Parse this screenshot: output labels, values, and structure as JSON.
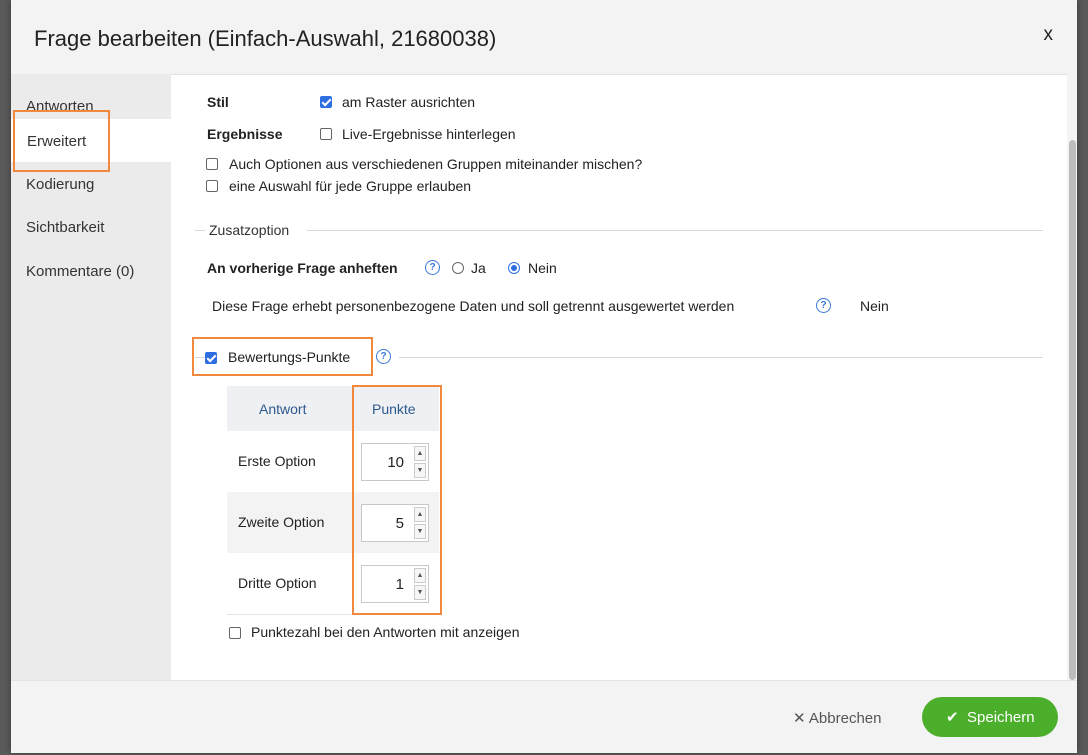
{
  "header": {
    "title": "Frage bearbeiten (Einfach-Auswahl, 21680038)",
    "close_label": "x"
  },
  "sidebar": {
    "items": [
      {
        "label": "Antworten",
        "active": false
      },
      {
        "label": "Erweitert",
        "active": true
      },
      {
        "label": "Kodierung",
        "active": false
      },
      {
        "label": "Sichtbarkeit",
        "active": false
      },
      {
        "label": "Kommentare (0)",
        "active": false
      }
    ]
  },
  "options": {
    "stil_label": "Stil",
    "stil_checkbox_label": "am Raster ausrichten",
    "stil_checked": true,
    "ergebnisse_label": "Ergebnisse",
    "ergebnisse_checkbox_label": "Live-Ergebnisse hinterlegen",
    "ergebnisse_checked": false,
    "mix_groups_label": "Auch Optionen aus verschiedenen Gruppen miteinander mischen?",
    "mix_groups_checked": false,
    "one_per_group_label": "eine Auswahl für jede Gruppe erlauben",
    "one_per_group_checked": false
  },
  "zusatzoption": {
    "legend": "Zusatzoption",
    "attach_label": "An vorherige Frage anheften",
    "attach_options": [
      "Ja",
      "Nein"
    ],
    "attach_selected": "Nein",
    "personal_data_label": "Diese Frage erhebt personenbezogene Daten und soll getrennt ausgewertet werden",
    "personal_data_value": "Nein"
  },
  "scoring": {
    "legend": "Bewertungs-Punkte",
    "enabled": true,
    "columns": [
      "Antwort",
      "Punkte"
    ],
    "rows": [
      {
        "answer": "Erste Option",
        "points": "10"
      },
      {
        "answer": "Zweite Option",
        "points": "5"
      },
      {
        "answer": "Dritte Option",
        "points": "1"
      }
    ],
    "show_points_label": "Punktezahl bei den Antworten mit anzeigen",
    "show_points_checked": false
  },
  "footer": {
    "cancel_label": "Abbrechen",
    "save_label": "Speichern"
  },
  "colors": {
    "accent": "#2f6ee0",
    "highlight": "#f0883e",
    "save": "#4caf2c"
  },
  "icons": {
    "close": "close-icon",
    "cancel": "x-icon",
    "save": "check-icon",
    "help": "help-icon"
  }
}
